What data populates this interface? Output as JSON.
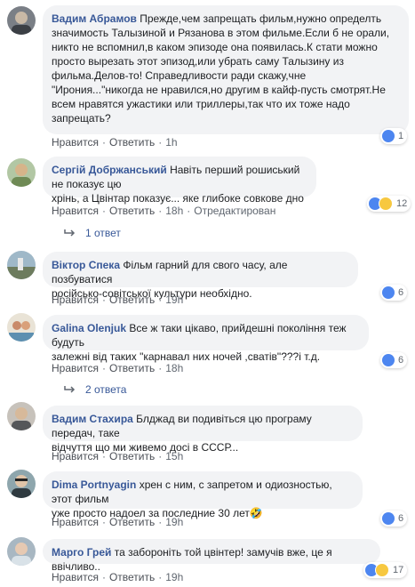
{
  "actions": {
    "like": "Нравится",
    "reply": "Ответить",
    "edited": "Отредактирован"
  },
  "icons": {
    "like": "like-icon",
    "haha": "haha-icon",
    "reply_arrow": "reply-arrow-icon"
  },
  "colors": {
    "author": "#385898",
    "bubble": "#f2f3f5",
    "like": "#4d86f0",
    "haha": "#f7c840"
  },
  "comments": [
    {
      "author": "Вадим Абрамов",
      "lines": [
        "Прежде,чем запрещать фильм,нужно определть",
        "значимость Талызиной и Рязанова в этом фильме.Если б не орали,",
        "никто не вспомнил,в каком эпизоде она появилась.К стати можно",
        "просто вырезать этот эпизод,или убрать саму Талызину из",
        "фильма.Делов-то! Справедливости ради скажу,чне",
        "\"Ирония...\"никогда не нравился,но другим в кайф-пусть смотрят.Не",
        "всем нравятся ужастики или триллеры,так что их тоже надо",
        "запрещать?"
      ],
      "time": "1h",
      "reactions": "1"
    },
    {
      "author": "Сергій Добржанський",
      "lines": [
        "Навіть перший рошиський не показує цю",
        "хрінь, а Цвінтар показує... яке глибоке совкове дно"
      ],
      "time": "18h",
      "reactions": "12",
      "replies": "1 ответ"
    },
    {
      "author": "Віктор Спека",
      "lines": [
        "Фільм гарний для свого часу, але позбуватися",
        "російсько-совітської культури необхідно."
      ],
      "time": "19h",
      "reactions": "6"
    },
    {
      "author": "Galina Olenjuk",
      "lines": [
        "Все ж таки цікаво, прийдешні покоління теж будуть",
        "залежні від таких \"карнавал них ночей ,сватів\"???і т.д."
      ],
      "time": "18h",
      "reactions": "6",
      "replies": "2 ответа"
    },
    {
      "author": "Вадим Стахира",
      "lines": [
        "Блджад ви подивіться цю програму передач, таке",
        "відчуття що ми живемо досі в СССР..."
      ],
      "time": "15h"
    },
    {
      "author": "Dima Portnyagin",
      "lines": [
        "хрен с ним, с запретом и одиозностью, этот фильм",
        "уже просто надоел за последние 30 лет🤣"
      ],
      "time": "19h",
      "reactions": "6"
    },
    {
      "author": "Марго Грей",
      "lines": [
        "та забороніть той цвінтер! замучів вже, це я ввічливо.."
      ],
      "time": "19h",
      "reactions": "17"
    }
  ]
}
